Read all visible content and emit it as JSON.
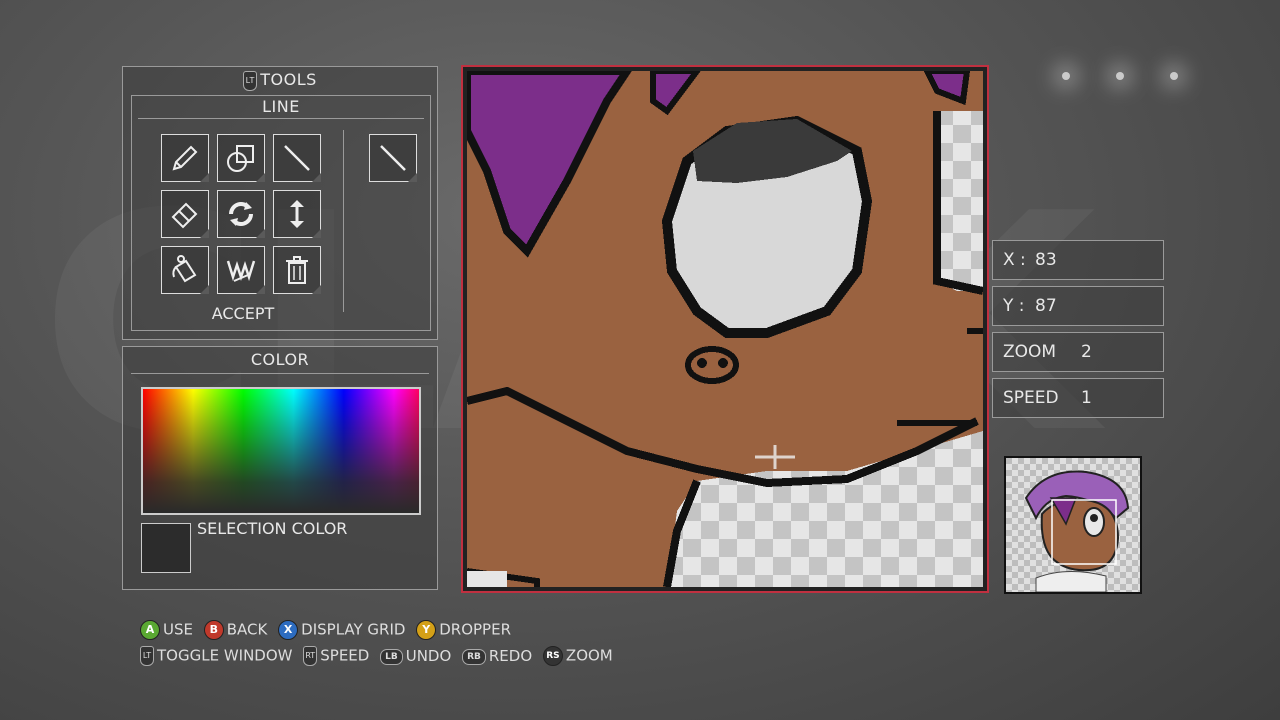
{
  "tools_panel": {
    "title": "TOOLS",
    "subtitle": "LINE",
    "accept_label": "ACCEPT",
    "tools": [
      {
        "icon": "pencil-icon"
      },
      {
        "icon": "shapes-icon"
      },
      {
        "icon": "line-icon"
      },
      {
        "icon": "eraser-icon"
      },
      {
        "icon": "rotate-icon"
      },
      {
        "icon": "flip-vertical-icon"
      },
      {
        "icon": "paint-bucket-icon"
      },
      {
        "icon": "wwe-logo-icon"
      },
      {
        "icon": "trash-icon"
      }
    ],
    "selected_tool_icon": "line-icon"
  },
  "color_panel": {
    "title": "COLOR",
    "selection_label": "SELECTION COLOR",
    "selection_color": "#2c2c2c"
  },
  "stats": {
    "x_label": "X :",
    "x_value": "83",
    "y_label": "Y :",
    "y_value": "87",
    "zoom_label": "ZOOM",
    "zoom_value": "2",
    "speed_label": "SPEED",
    "speed_value": "1"
  },
  "legend": {
    "row1": [
      {
        "btn": "A",
        "color": "#5aa832",
        "label": "USE"
      },
      {
        "btn": "B",
        "color": "#c0392b",
        "label": "BACK"
      },
      {
        "btn": "X",
        "color": "#2d6cc0",
        "label": "DISPLAY GRID"
      },
      {
        "btn": "Y",
        "color": "#d4a017",
        "label": "DROPPER"
      }
    ],
    "row2": [
      {
        "btn": "LT",
        "label": "TOGGLE WINDOW"
      },
      {
        "btn": "RT",
        "label": "SPEED"
      },
      {
        "btn": "LB",
        "label": "UNDO"
      },
      {
        "btn": "RB",
        "label": "REDO"
      },
      {
        "btn": "RS",
        "label": "ZOOM"
      }
    ]
  },
  "colors": {
    "skin": "#9a6240",
    "outline": "#111111",
    "purple": "#7c2e8a",
    "eye_white": "#d8d8d8",
    "eye_dark": "#3a3a3a",
    "frame_accent": "#c03040"
  }
}
